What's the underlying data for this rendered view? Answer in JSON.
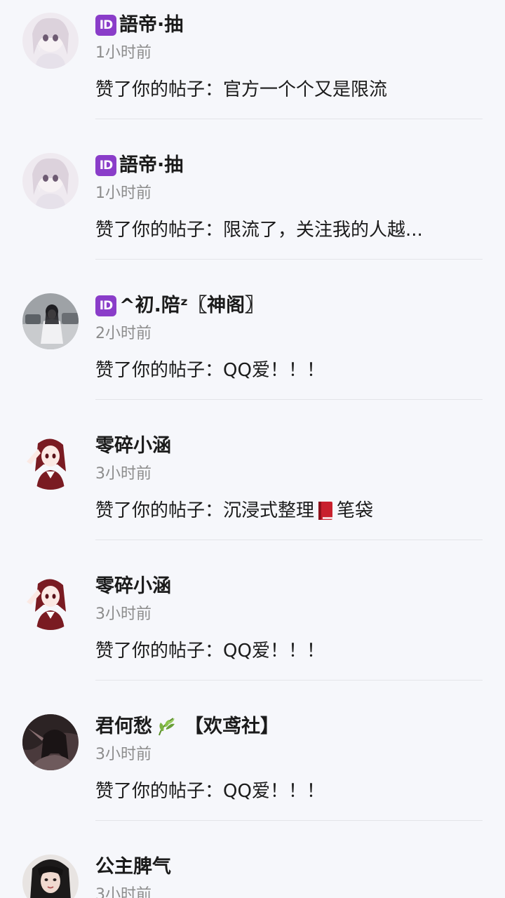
{
  "notifications": [
    {
      "user": "語帝·抽",
      "has_id_badge": true,
      "time": "1小时前",
      "action": "赞了你的帖子：",
      "post": "官方一个个又是限流",
      "avatar": "avatar-anime-girl-white"
    },
    {
      "user": "語帝·抽",
      "has_id_badge": true,
      "time": "1小时前",
      "action": "赞了你的帖子：",
      "post": "限流了，关注我的人越...",
      "avatar": "avatar-anime-girl-white"
    },
    {
      "user": "^初.陪ᶻ〖神阁〗",
      "has_id_badge": true,
      "time": "2小时前",
      "action": "赞了你的帖子：",
      "post": "QQ爱！！！",
      "avatar": "avatar-girl-photo-street"
    },
    {
      "user": "零碎小涵",
      "has_id_badge": false,
      "time": "3小时前",
      "action": "赞了你的帖子：",
      "post_before": "沉浸式整理",
      "post_after": "笔袋",
      "avatar": "avatar-anime-girl-red"
    },
    {
      "user": "零碎小涵",
      "has_id_badge": false,
      "time": "3小时前",
      "action": "赞了你的帖子：",
      "post": "QQ爱！！！",
      "avatar": "avatar-anime-girl-red"
    },
    {
      "user_before": "君何愁",
      "user_after": "【欢鸢社】",
      "has_id_badge": false,
      "time": "3小时前",
      "action": "赞了你的帖子：",
      "post": "QQ爱！！！",
      "avatar": "avatar-dark-art"
    },
    {
      "user": "公主脾气",
      "has_id_badge": false,
      "time": "3小时前",
      "action": "",
      "post": "",
      "avatar": "avatar-girl-photo-dark"
    }
  ],
  "id_badge_text": "ID",
  "colors": {
    "background": "#f6f7fb",
    "id_badge": "#8a3dc9",
    "time_text": "#8c8c8c",
    "divider": "#e3e4e8"
  }
}
